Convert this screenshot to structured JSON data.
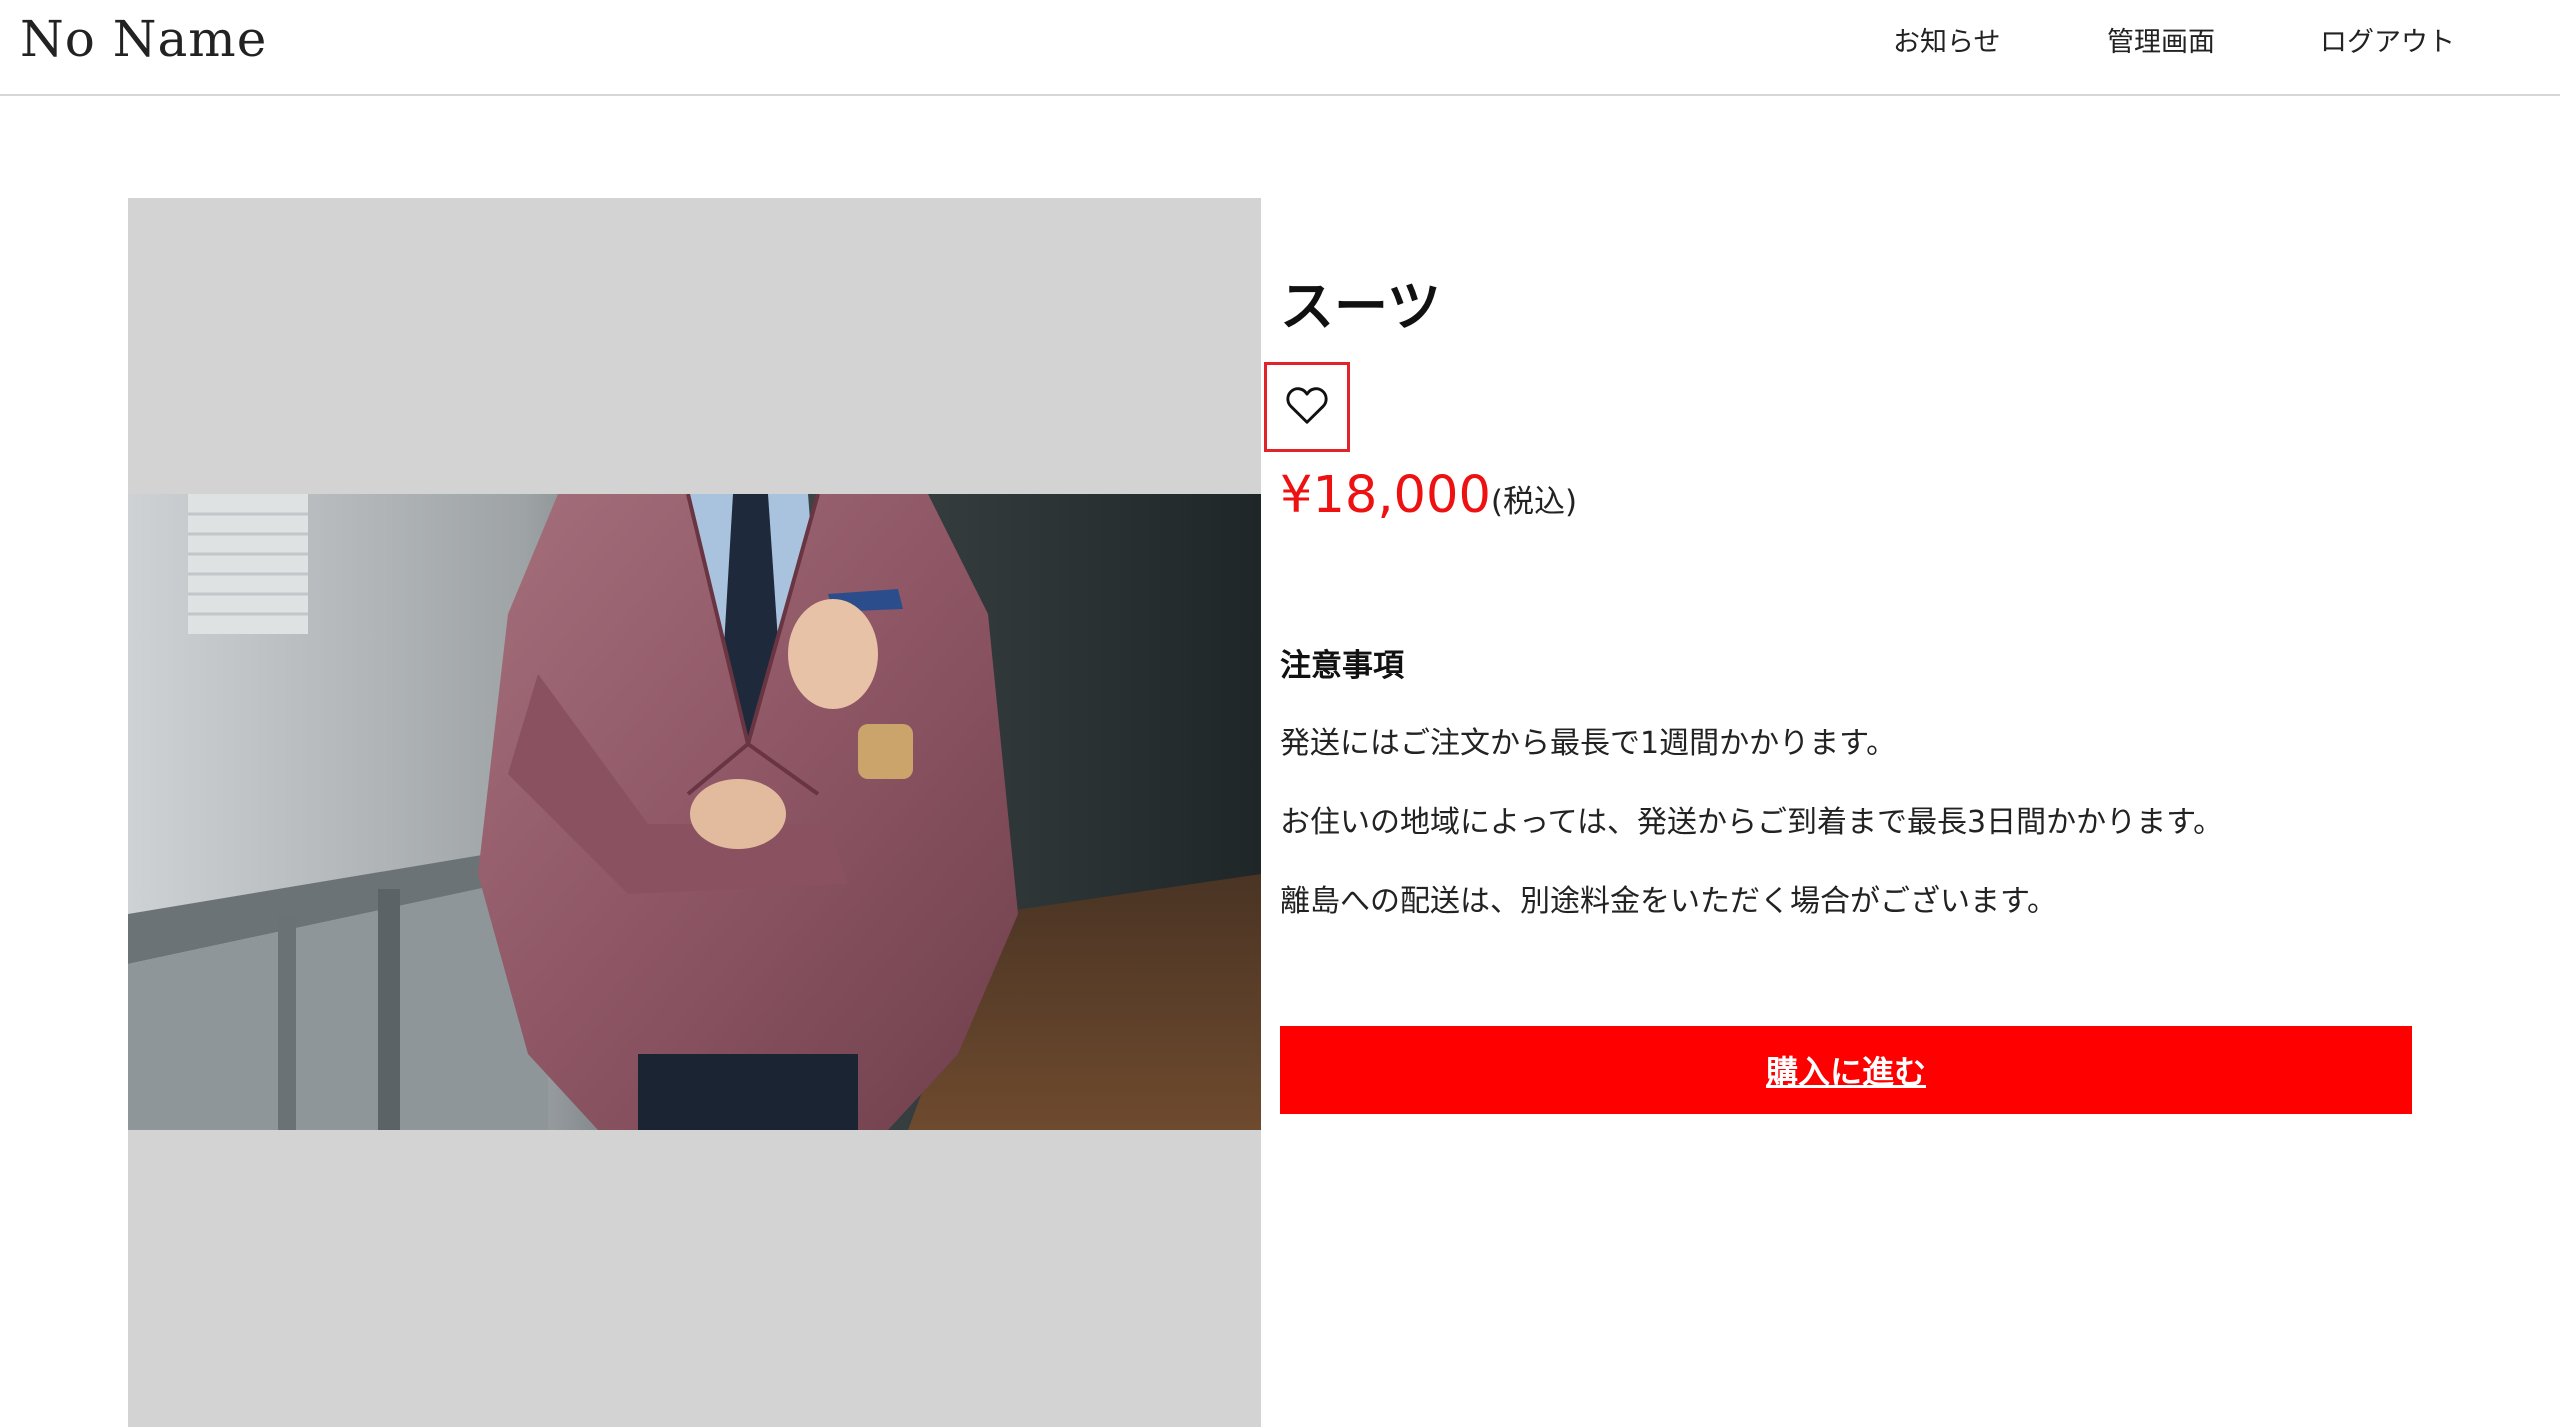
{
  "header": {
    "logo": "No Name",
    "nav": [
      {
        "label": "お知らせ"
      },
      {
        "label": "管理画面"
      },
      {
        "label": "ログアウト"
      }
    ]
  },
  "product": {
    "name": "スーツ",
    "favorite_icon": "heart-outline-icon",
    "price": "¥18,000",
    "tax_note": "(税込)"
  },
  "notes": {
    "title": "注意事項",
    "items": [
      "発送にはご注文から最長で1週間かかります。",
      "お住いの地域によっては、発送からご到着まで最長3日間かかります。",
      "離島への配送は、別途料金をいただく場合がございます。"
    ]
  },
  "actions": {
    "buy_label": "購入に進む"
  },
  "colors": {
    "price": "#ee1111",
    "buy_button": "#ff0000",
    "favorite_border": "#e0242a",
    "image_background": "#d3d3d3"
  }
}
